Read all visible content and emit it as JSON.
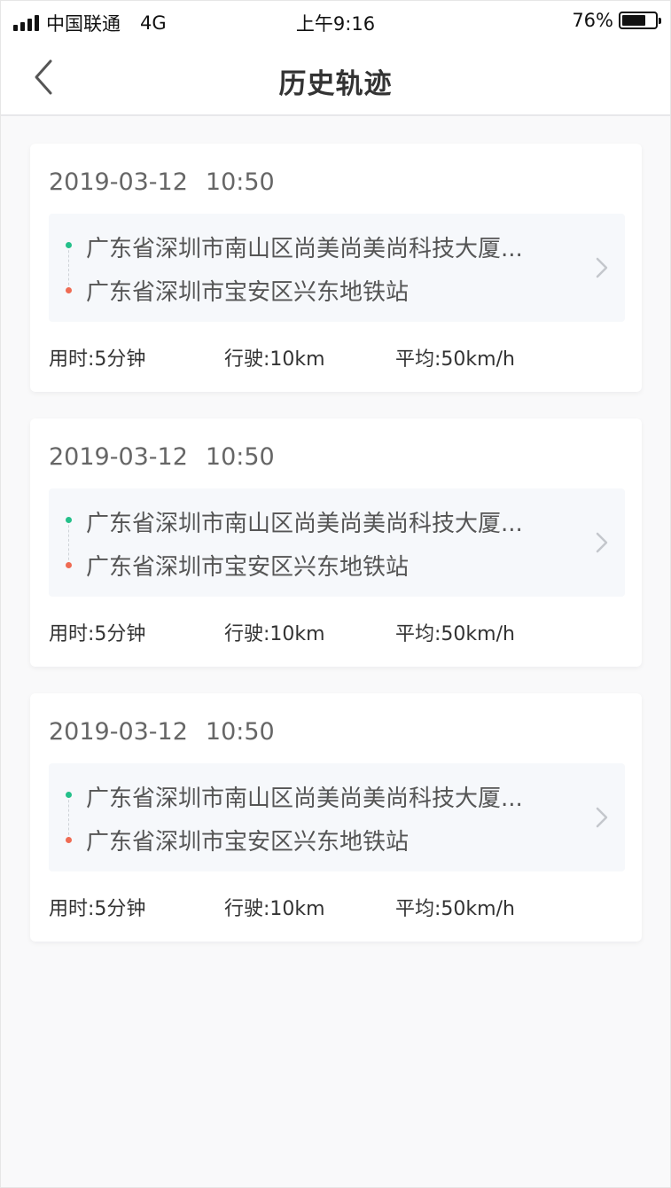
{
  "status_bar": {
    "carrier": "中国联通",
    "network": "4G",
    "time": "上午9:16",
    "battery_percent": "76%",
    "battery_level": 0.76
  },
  "nav": {
    "title": "历史轨迹",
    "back_icon": "chevron-left-icon"
  },
  "colors": {
    "start_dot": "#24c08a",
    "end_dot": "#ef6b53",
    "route_bg": "#f6f8fb"
  },
  "trips": [
    {
      "date": "2019-03-12",
      "time": "10:50",
      "start": "广东省深圳市南山区尚美尚美尚科技大厦...",
      "end": "广东省深圳市宝安区兴东地铁站",
      "duration": "用时:5分钟",
      "distance": "行驶:10km",
      "avg_speed": "平均:50km/h"
    },
    {
      "date": "2019-03-12",
      "time": "10:50",
      "start": "广东省深圳市南山区尚美尚美尚科技大厦...",
      "end": "广东省深圳市宝安区兴东地铁站",
      "duration": "用时:5分钟",
      "distance": "行驶:10km",
      "avg_speed": "平均:50km/h"
    },
    {
      "date": "2019-03-12",
      "time": "10:50",
      "start": "广东省深圳市南山区尚美尚美尚科技大厦...",
      "end": "广东省深圳市宝安区兴东地铁站",
      "duration": "用时:5分钟",
      "distance": "行驶:10km",
      "avg_speed": "平均:50km/h"
    }
  ]
}
